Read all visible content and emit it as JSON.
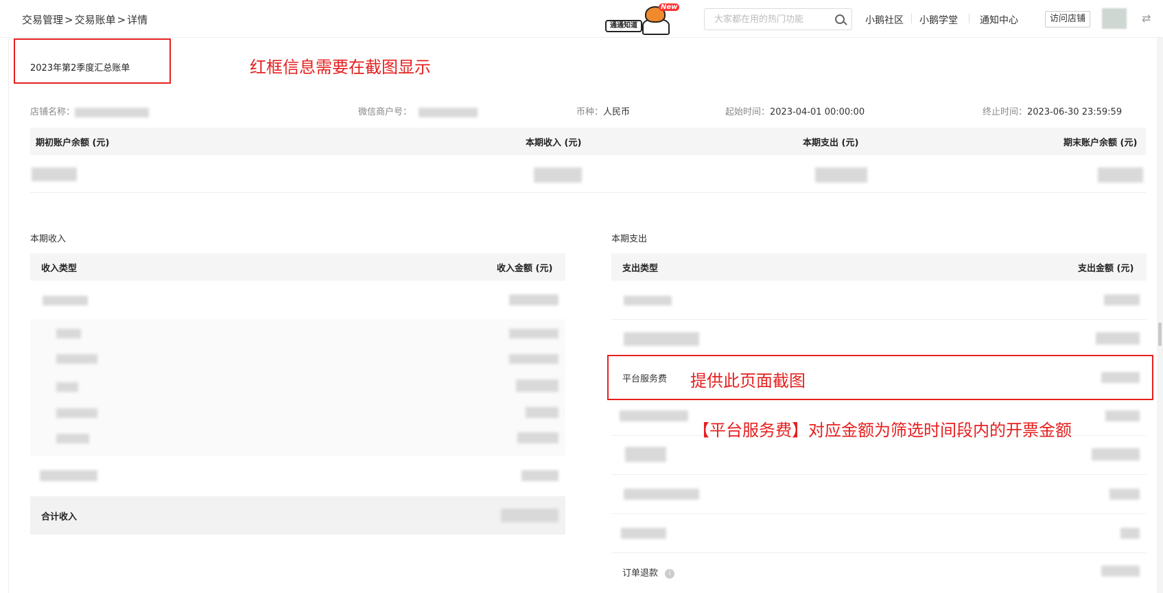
{
  "breadcrumb": {
    "items": [
      "交易管理",
      "交易账单",
      "详情"
    ],
    "separator": ">"
  },
  "header": {
    "promo_label": "通通知道",
    "promo_badge": "New",
    "search_placeholder": "大家都在用的热门功能",
    "nav_links": [
      "小鹅社区",
      "小鹅学堂",
      "通知中心"
    ],
    "visit_store_label": "访问店铺"
  },
  "bill": {
    "title": "2023年第2季度汇总账单",
    "store_name_label": "店铺名称：",
    "merchant_id_label": "微信商户号：",
    "currency_label": "币种：",
    "currency_value": "人民币",
    "start_label": "起始时间：",
    "start_value": "2023-04-01 00:00:00",
    "end_label": "终止时间：",
    "end_value": "2023-06-30 23:59:59"
  },
  "summary": {
    "columns": [
      "期初账户余额 (元)",
      "本期收入 (元)",
      "本期支出 (元)",
      "期末账户余额 (元)"
    ]
  },
  "income": {
    "section_title": "本期收入",
    "col_type": "收入类型",
    "col_amount": "收入金额 (元)",
    "total_label": "合计收入"
  },
  "expense": {
    "section_title": "本期支出",
    "col_type": "支出类型",
    "col_amount": "支出金额 (元)",
    "platform_fee_label": "平台服务费",
    "refund_label": "订单退款"
  },
  "annotations": {
    "note_top": "红框信息需要在截图显示",
    "note_middle": "提供此页面截图",
    "note_bottom": "【平台服务费】对应金额为筛选时间段内的开票金额"
  },
  "colors": {
    "annotation_red": "#e61f1f",
    "table_header_bg": "#f5f5f5"
  }
}
